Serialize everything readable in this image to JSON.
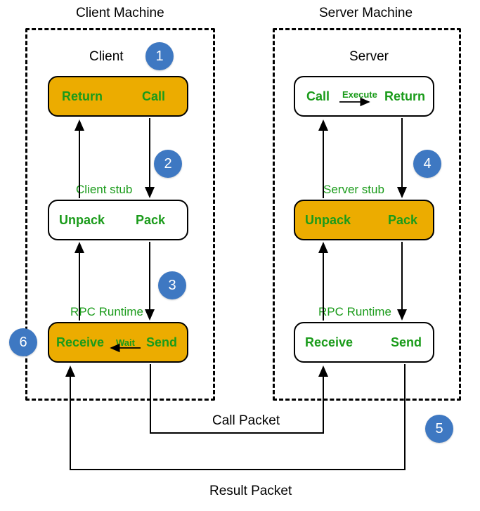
{
  "titles": {
    "client_machine": "Client Machine",
    "server_machine": "Server Machine",
    "client": "Client",
    "server": "Server",
    "client_stub": "Client stub",
    "server_stub": "Server stub",
    "rpc_runtime_left": "RPC Runtime",
    "rpc_runtime_right": "RPC Runtime",
    "call_packet": "Call Packet",
    "result_packet": "Result Packet"
  },
  "nodes": {
    "client_top": {
      "left": "Return",
      "right": "Call"
    },
    "client_mid": {
      "left": "Unpack",
      "right": "Pack"
    },
    "client_bot": {
      "left": "Receive",
      "mid": "Wait",
      "right": "Send"
    },
    "server_top": {
      "left": "Call",
      "mid": "Execute",
      "right": "Return"
    },
    "server_mid": {
      "left": "Unpack",
      "right": "Pack"
    },
    "server_bot": {
      "left": "Receive",
      "right": "Send"
    }
  },
  "badges": {
    "b1": "1",
    "b2": "2",
    "b3": "3",
    "b4": "4",
    "b5": "5",
    "b6": "6"
  }
}
